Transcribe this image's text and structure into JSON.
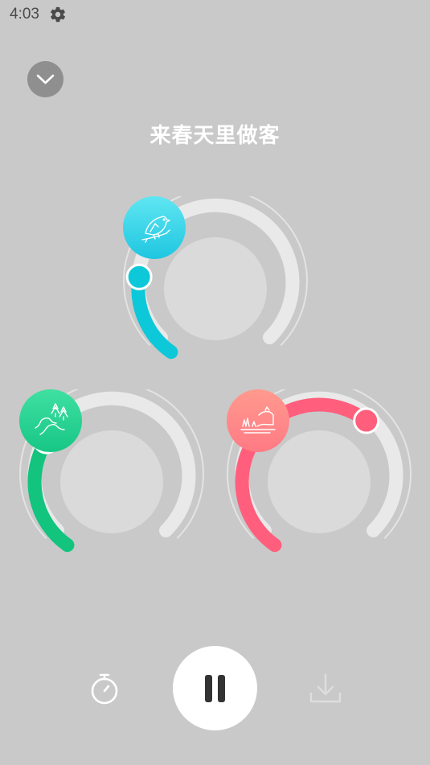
{
  "status_bar": {
    "time": "4:03",
    "settings_icon": "gear-icon"
  },
  "header": {
    "collapse_icon": "chevron-down-icon",
    "title": "来春天里做客"
  },
  "sound_mixers": [
    {
      "name": "bird",
      "icon": "bird-icon",
      "accent": "#0dc8d8",
      "level": 0.22
    },
    {
      "name": "stream",
      "icon": "stream-icon",
      "accent": "#12c47e",
      "level": 0.3
    },
    {
      "name": "grass",
      "icon": "grass-icon",
      "accent": "#ff5f7c",
      "level": 0.63
    }
  ],
  "controls": {
    "timer_icon": "timer-icon",
    "play_state": "playing",
    "pause_icon": "pause-icon",
    "download_icon": "download-icon"
  },
  "colors": {
    "background": "#c9c9c9",
    "track": "#e9e9e9",
    "inner_ring": "#dadada"
  }
}
